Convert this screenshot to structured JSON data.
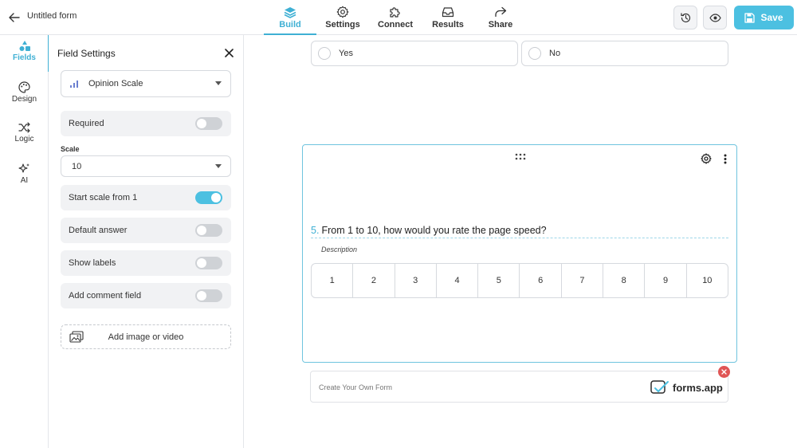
{
  "header": {
    "form_title": "Untitled form",
    "tabs": [
      {
        "label": "Build",
        "icon": "layers-icon",
        "active": true
      },
      {
        "label": "Settings",
        "icon": "gear-icon",
        "active": false
      },
      {
        "label": "Connect",
        "icon": "puzzle-icon",
        "active": false
      },
      {
        "label": "Results",
        "icon": "inbox-icon",
        "active": false
      },
      {
        "label": "Share",
        "icon": "share-icon",
        "active": false
      }
    ],
    "save_label": "Save"
  },
  "rail": {
    "items": [
      {
        "label": "Fields",
        "icon": "shapes-icon",
        "active": true
      },
      {
        "label": "Design",
        "icon": "palette-icon",
        "active": false
      },
      {
        "label": "Logic",
        "icon": "shuffle-icon",
        "active": false
      },
      {
        "label": "AI",
        "icon": "sparkle-icon",
        "active": false
      }
    ]
  },
  "panel": {
    "title": "Field Settings",
    "field_type": "Opinion Scale",
    "required": {
      "label": "Required",
      "on": false
    },
    "scale_label": "Scale",
    "scale_value": "10",
    "start_from_one": {
      "label": "Start scale from 1",
      "on": true
    },
    "default_answer": {
      "label": "Default answer",
      "on": false
    },
    "show_labels": {
      "label": "Show labels",
      "on": false
    },
    "comment_field": {
      "label": "Add comment field",
      "on": false
    },
    "add_media_label": "Add image or video"
  },
  "canvas": {
    "options": [
      {
        "label": "Yes"
      },
      {
        "label": "No"
      }
    ],
    "question": {
      "number": "5.",
      "text": "From 1 to 10, how would you rate the page speed?",
      "description": "Description",
      "scale": [
        "1",
        "2",
        "3",
        "4",
        "5",
        "6",
        "7",
        "8",
        "9",
        "10"
      ]
    },
    "branding": {
      "text": "Create Your Own Form",
      "logo_text": "forms.app"
    }
  },
  "colors": {
    "accent": "#3fb0d4",
    "save_button": "#4cc0e1",
    "close_badge": "#e05555"
  }
}
